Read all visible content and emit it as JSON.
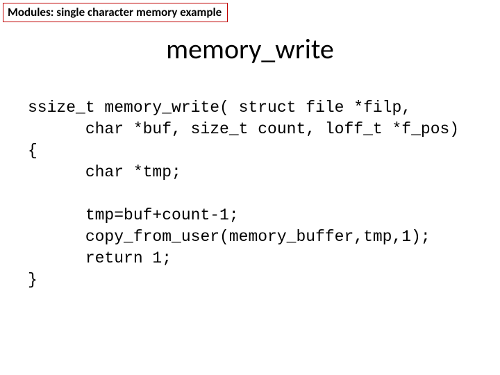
{
  "breadcrumb": "Modules: single character memory example",
  "title": "memory_write",
  "code": "ssize_t memory_write( struct file *filp,\n      char *buf, size_t count, loff_t *f_pos)\n{\n      char *tmp;\n\n      tmp=buf+count-1;\n      copy_from_user(memory_buffer,tmp,1);\n      return 1;\n}"
}
